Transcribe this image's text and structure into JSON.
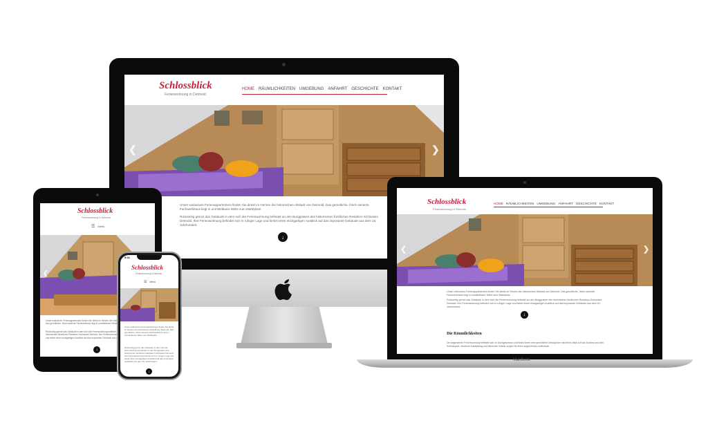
{
  "site": {
    "logo": "Schlossblick",
    "tagline": "Ferienwohnung in Detmold",
    "nav": [
      "HOME",
      "RÄUMLICHKEITEN",
      "UMGEBUNG",
      "ANFAHRT",
      "GESCHICHTE",
      "KONTAKT"
    ],
    "menu_label": "Menü",
    "intro_p1": "Unser exklusives Ferienappartement finden Sie direkt im Herzen der historischen Altstadt von Detmold. Das gemütliche, frisch sanierte Fachwerkhaus liegt in unmittelbarer Nähe zum Marktplatz.",
    "intro_p2": "Rückseitig grenzt das Gebäude in dem sich die Ferienwohnung befindet an den Burggraben des historischen fürstlichen Residenz-Schlosses Detmold. Ihre Ferienwohnung befindet sich in ruhiger Lage und bietet einen einzigartigen Ausblick auf das imposante Gebäude aus dem 16. Jahrhundert.",
    "section_heading": "Die Räumlichkeiten",
    "section_p": "Die angenehme Ferienwohnung befindet sich im Dachgeschoss und bietet Ihnen eine gemütliche Atmosphäre mit freiem Blick auf das Schloss und den Schlosspark. Moderne Ausstattung und liebevolle Details sorgen für einen angenehmen Aufenthalt."
  },
  "devices": {
    "macbook_label": "MacBook",
    "phone_time": "9:41"
  },
  "colors": {
    "accent": "#c8203a",
    "bezel": "#0b0b0b",
    "aluminium": "#cfd0d2"
  }
}
